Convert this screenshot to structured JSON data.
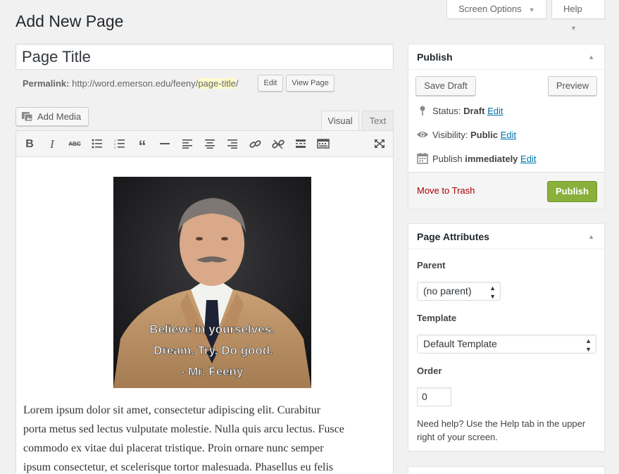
{
  "header": {
    "screen_options": "Screen Options",
    "help": "Help",
    "title": "Add New Page"
  },
  "post": {
    "title_value": "Page Title",
    "permalink_label": "Permalink:",
    "permalink_base": "http://word.emerson.edu/feeny/",
    "permalink_slug": "page-title",
    "permalink_tail": "/",
    "permalink_edit": "Edit",
    "view_page": "View Page"
  },
  "editor": {
    "add_media": "Add Media",
    "tab_visual": "Visual",
    "tab_text": "Text",
    "toolbar": [
      "bold-icon",
      "italic-icon",
      "strikethrough-icon",
      "bullet-list-icon",
      "numbered-list-icon",
      "blockquote-icon",
      "horizontal-rule-icon",
      "align-left-icon",
      "align-center-icon",
      "align-right-icon",
      "link-icon",
      "unlink-icon",
      "read-more-icon",
      "toolbar-toggle-icon",
      "fullscreen-icon"
    ],
    "image_caption_lines": [
      "Believe in yourselves.",
      "Dream. Try. Do good.",
      "- Mr. Feeny"
    ],
    "body_lines": [
      "Lorem ipsum dolor sit amet, consectetur adipiscing elit. Curabitur",
      "porta metus sed lectus vulputate molestie. Nulla quis arcu lectus. Fusce",
      "commodo ex vitae dui placerat tristique. Proin ornare nunc semper",
      "ipsum consectetur, et scelerisque tortor malesuada. Phasellus eu felis"
    ]
  },
  "publish": {
    "heading": "Publish",
    "save_draft": "Save Draft",
    "preview": "Preview",
    "status_label": "Status:",
    "status_value": "Draft",
    "visibility_label": "Visibility:",
    "visibility_value": "Public",
    "publish_label": "Publish",
    "publish_value": "immediately",
    "edit": "Edit",
    "trash": "Move to Trash",
    "publish_button": "Publish",
    "publish_color": "#8ab03c",
    "trash_color": "#aa0000"
  },
  "attributes": {
    "heading": "Page Attributes",
    "parent_label": "Parent",
    "parent_value": "(no parent)",
    "template_label": "Template",
    "template_value": "Default Template",
    "order_label": "Order",
    "order_value": "0",
    "help_text": "Need help? Use the Help tab in the upper right of your screen."
  }
}
